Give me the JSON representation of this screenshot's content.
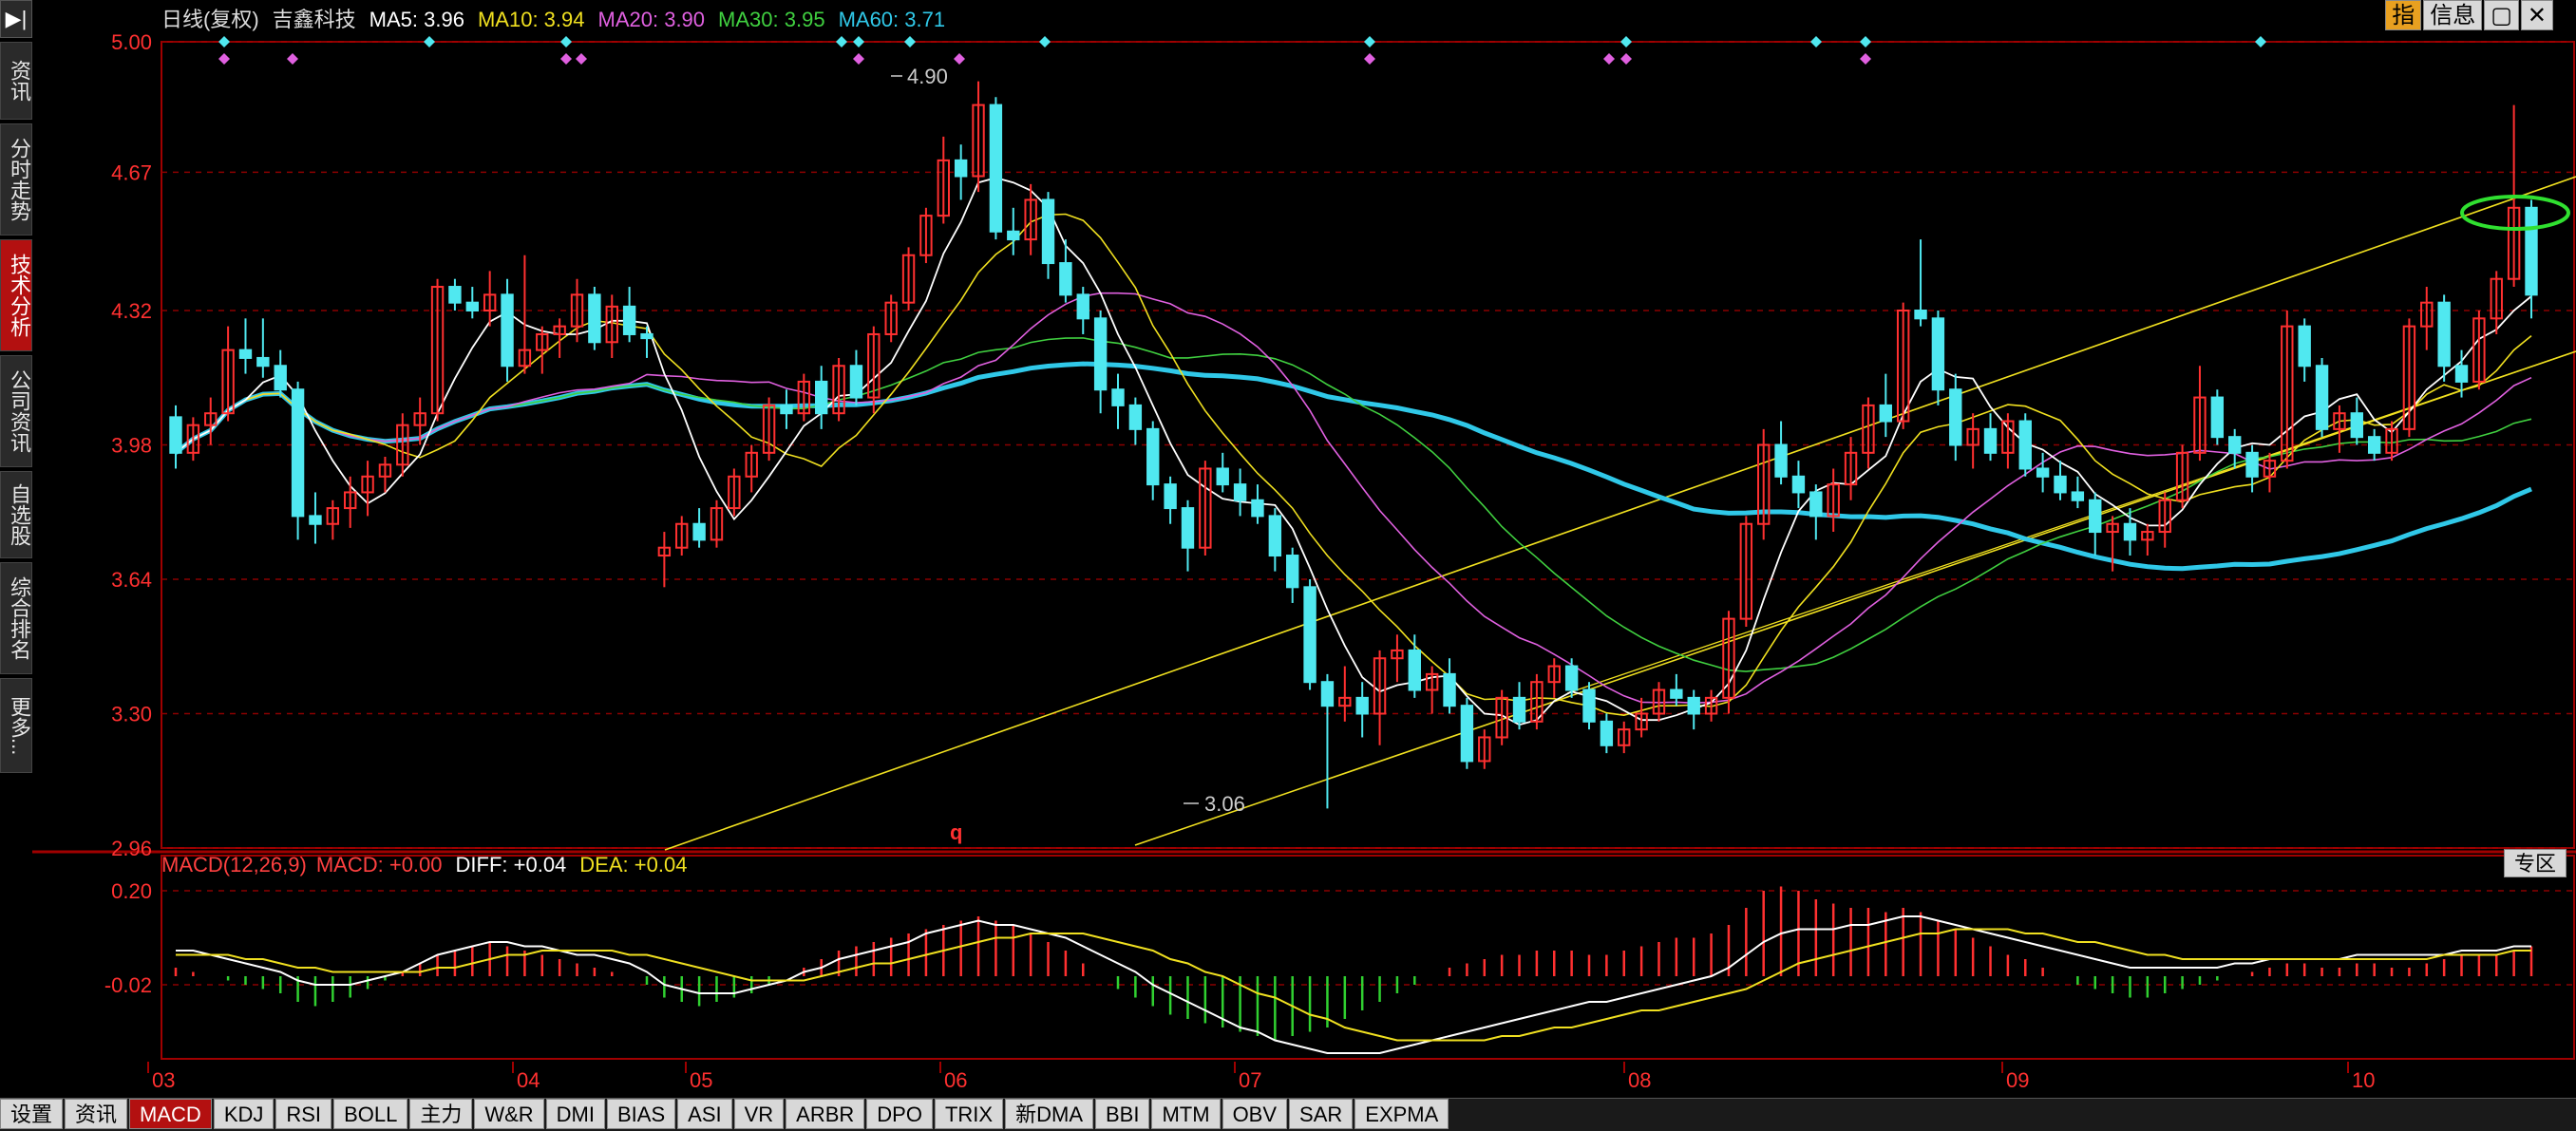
{
  "header": {
    "title": "日线(复权)",
    "stock_name": "吉鑫科技",
    "ma": [
      {
        "label": "MA5:",
        "value": "3.96",
        "color": "#ffffff"
      },
      {
        "label": "MA10:",
        "value": "3.94",
        "color": "#f0e020"
      },
      {
        "label": "MA20:",
        "value": "3.90",
        "color": "#e060e0"
      },
      {
        "label": "MA30:",
        "value": "3.95",
        "color": "#40d040"
      },
      {
        "label": "MA60:",
        "value": "3.71",
        "color": "#30c8e8"
      }
    ]
  },
  "top_buttons": [
    "指",
    "信息",
    "▢",
    "✕"
  ],
  "sidebar": {
    "top_icon": "▶|",
    "items": [
      {
        "label": "资讯"
      },
      {
        "label": "分时走势"
      },
      {
        "label": "技术分析"
      },
      {
        "label": "公司资讯"
      },
      {
        "label": "自选股"
      },
      {
        "label": "综合排名"
      },
      {
        "label": "更多..."
      }
    ]
  },
  "price_axis": {
    "ticks": [
      "5.00",
      "4.67",
      "4.32",
      "3.98",
      "3.64",
      "3.30",
      "2.96"
    ]
  },
  "macd_axis": {
    "ticks": [
      "0.20",
      "-0.02"
    ]
  },
  "macd_header": {
    "label": "MACD(12,26,9)",
    "macd": "MACD: +0.00",
    "diff_label": "DIFF:",
    "diff": "+0.04",
    "dea_label": "DEA:",
    "dea": "+0.04"
  },
  "annotations": {
    "high": "4.90",
    "low": "3.06",
    "marker": "q"
  },
  "zone_button": "专区",
  "date_axis": [
    "03",
    "04",
    "05",
    "06",
    "07",
    "08",
    "09",
    "10"
  ],
  "tabs": [
    "设置",
    "资讯",
    "MACD",
    "KDJ",
    "RSI",
    "BOLL",
    "主力",
    "W&R",
    "DMI",
    "BIAS",
    "ASI",
    "VR",
    "ARBR",
    "DPO",
    "TRIX",
    "新DMA",
    "BBI",
    "MTM",
    "OBV",
    "SAR",
    "EXPMA"
  ],
  "active_tab": "MACD",
  "colors": {
    "up": "#ff3030",
    "down": "#50e8f0",
    "grid": "#8b0000",
    "axis": "#a00000"
  },
  "chart_data": {
    "type": "candlestick",
    "ylim": [
      2.96,
      5.0
    ],
    "candles_o_h_l_c": [
      [
        4.05,
        4.08,
        3.92,
        3.96
      ],
      [
        3.96,
        4.05,
        3.94,
        4.03
      ],
      [
        4.03,
        4.1,
        3.98,
        4.06
      ],
      [
        4.06,
        4.28,
        4.04,
        4.22
      ],
      [
        4.22,
        4.3,
        4.16,
        4.2
      ],
      [
        4.2,
        4.3,
        4.15,
        4.18
      ],
      [
        4.18,
        4.22,
        4.1,
        4.12
      ],
      [
        4.12,
        4.14,
        3.74,
        3.8
      ],
      [
        3.8,
        3.86,
        3.73,
        3.78
      ],
      [
        3.78,
        3.84,
        3.74,
        3.82
      ],
      [
        3.82,
        3.9,
        3.77,
        3.86
      ],
      [
        3.86,
        3.94,
        3.8,
        3.9
      ],
      [
        3.9,
        3.95,
        3.86,
        3.93
      ],
      [
        3.93,
        4.06,
        3.9,
        4.03
      ],
      [
        4.03,
        4.1,
        3.98,
        4.06
      ],
      [
        4.06,
        4.4,
        4.04,
        4.38
      ],
      [
        4.38,
        4.4,
        4.32,
        4.34
      ],
      [
        4.34,
        4.38,
        4.3,
        4.32
      ],
      [
        4.32,
        4.42,
        4.28,
        4.36
      ],
      [
        4.36,
        4.4,
        4.14,
        4.18
      ],
      [
        4.18,
        4.46,
        4.16,
        4.22
      ],
      [
        4.22,
        4.28,
        4.16,
        4.26
      ],
      [
        4.26,
        4.3,
        4.2,
        4.28
      ],
      [
        4.28,
        4.4,
        4.24,
        4.36
      ],
      [
        4.36,
        4.38,
        4.22,
        4.24
      ],
      [
        4.24,
        4.36,
        4.2,
        4.33
      ],
      [
        4.33,
        4.38,
        4.24,
        4.26
      ],
      [
        4.26,
        4.28,
        4.2,
        4.25
      ],
      [
        3.7,
        3.76,
        3.62,
        3.72
      ],
      [
        3.72,
        3.8,
        3.7,
        3.78
      ],
      [
        3.78,
        3.82,
        3.72,
        3.74
      ],
      [
        3.74,
        3.84,
        3.72,
        3.82
      ],
      [
        3.82,
        3.92,
        3.8,
        3.9
      ],
      [
        3.9,
        3.98,
        3.86,
        3.96
      ],
      [
        3.96,
        4.1,
        3.94,
        4.08
      ],
      [
        4.08,
        4.12,
        4.02,
        4.06
      ],
      [
        4.06,
        4.16,
        4.04,
        4.14
      ],
      [
        4.14,
        4.18,
        4.02,
        4.06
      ],
      [
        4.06,
        4.2,
        4.04,
        4.18
      ],
      [
        4.18,
        4.22,
        4.08,
        4.1
      ],
      [
        4.1,
        4.28,
        4.06,
        4.26
      ],
      [
        4.26,
        4.36,
        4.24,
        4.34
      ],
      [
        4.34,
        4.48,
        4.32,
        4.46
      ],
      [
        4.46,
        4.58,
        4.44,
        4.56
      ],
      [
        4.56,
        4.76,
        4.54,
        4.7
      ],
      [
        4.7,
        4.74,
        4.6,
        4.66
      ],
      [
        4.66,
        4.9,
        4.62,
        4.84
      ],
      [
        4.84,
        4.86,
        4.5,
        4.52
      ],
      [
        4.52,
        4.58,
        4.46,
        4.5
      ],
      [
        4.5,
        4.64,
        4.46,
        4.6
      ],
      [
        4.6,
        4.62,
        4.4,
        4.44
      ],
      [
        4.44,
        4.5,
        4.34,
        4.36
      ],
      [
        4.36,
        4.38,
        4.26,
        4.3
      ],
      [
        4.3,
        4.32,
        4.06,
        4.12
      ],
      [
        4.12,
        4.16,
        4.02,
        4.08
      ],
      [
        4.08,
        4.1,
        3.98,
        4.02
      ],
      [
        4.02,
        4.04,
        3.84,
        3.88
      ],
      [
        3.88,
        3.9,
        3.78,
        3.82
      ],
      [
        3.82,
        3.84,
        3.66,
        3.72
      ],
      [
        3.72,
        3.94,
        3.7,
        3.92
      ],
      [
        3.92,
        3.96,
        3.86,
        3.88
      ],
      [
        3.88,
        3.92,
        3.8,
        3.84
      ],
      [
        3.84,
        3.88,
        3.78,
        3.8
      ],
      [
        3.8,
        3.82,
        3.66,
        3.7
      ],
      [
        3.7,
        3.72,
        3.58,
        3.62
      ],
      [
        3.62,
        3.64,
        3.36,
        3.38
      ],
      [
        3.38,
        3.4,
        3.06,
        3.32
      ],
      [
        3.32,
        3.42,
        3.28,
        3.34
      ],
      [
        3.34,
        3.38,
        3.24,
        3.3
      ],
      [
        3.3,
        3.46,
        3.22,
        3.44
      ],
      [
        3.44,
        3.5,
        3.38,
        3.46
      ],
      [
        3.46,
        3.5,
        3.34,
        3.36
      ],
      [
        3.36,
        3.42,
        3.3,
        3.4
      ],
      [
        3.4,
        3.44,
        3.3,
        3.32
      ],
      [
        3.32,
        3.34,
        3.16,
        3.18
      ],
      [
        3.18,
        3.26,
        3.16,
        3.24
      ],
      [
        3.24,
        3.36,
        3.22,
        3.34
      ],
      [
        3.34,
        3.38,
        3.26,
        3.28
      ],
      [
        3.28,
        3.4,
        3.26,
        3.38
      ],
      [
        3.38,
        3.44,
        3.34,
        3.42
      ],
      [
        3.42,
        3.44,
        3.34,
        3.36
      ],
      [
        3.36,
        3.38,
        3.26,
        3.28
      ],
      [
        3.28,
        3.3,
        3.2,
        3.22
      ],
      [
        3.22,
        3.28,
        3.2,
        3.26
      ],
      [
        3.26,
        3.34,
        3.24,
        3.3
      ],
      [
        3.3,
        3.38,
        3.28,
        3.36
      ],
      [
        3.36,
        3.4,
        3.32,
        3.34
      ],
      [
        3.34,
        3.36,
        3.26,
        3.3
      ],
      [
        3.3,
        3.36,
        3.28,
        3.34
      ],
      [
        3.34,
        3.56,
        3.3,
        3.54
      ],
      [
        3.54,
        3.8,
        3.52,
        3.78
      ],
      [
        3.78,
        4.02,
        3.74,
        3.98
      ],
      [
        3.98,
        4.04,
        3.88,
        3.9
      ],
      [
        3.9,
        3.94,
        3.82,
        3.86
      ],
      [
        3.86,
        3.88,
        3.74,
        3.8
      ],
      [
        3.8,
        3.92,
        3.76,
        3.88
      ],
      [
        3.88,
        4.0,
        3.84,
        3.96
      ],
      [
        3.96,
        4.1,
        3.92,
        4.08
      ],
      [
        4.08,
        4.16,
        4.0,
        4.04
      ],
      [
        4.04,
        4.34,
        4.02,
        4.32
      ],
      [
        4.32,
        4.5,
        4.28,
        4.3
      ],
      [
        4.3,
        4.32,
        4.08,
        4.12
      ],
      [
        4.12,
        4.16,
        3.94,
        3.98
      ],
      [
        3.98,
        4.06,
        3.92,
        4.02
      ],
      [
        4.02,
        4.06,
        3.94,
        3.96
      ],
      [
        3.96,
        4.06,
        3.92,
        4.04
      ],
      [
        4.04,
        4.06,
        3.9,
        3.92
      ],
      [
        3.92,
        3.96,
        3.86,
        3.9
      ],
      [
        3.9,
        3.94,
        3.84,
        3.86
      ],
      [
        3.86,
        3.9,
        3.82,
        3.84
      ],
      [
        3.84,
        3.86,
        3.7,
        3.76
      ],
      [
        3.76,
        3.8,
        3.66,
        3.78
      ],
      [
        3.78,
        3.82,
        3.7,
        3.74
      ],
      [
        3.74,
        3.78,
        3.7,
        3.76
      ],
      [
        3.76,
        3.86,
        3.72,
        3.84
      ],
      [
        3.84,
        3.98,
        3.82,
        3.96
      ],
      [
        3.96,
        4.18,
        3.94,
        4.1
      ],
      [
        4.1,
        4.12,
        3.98,
        4.0
      ],
      [
        4.0,
        4.02,
        3.92,
        3.96
      ],
      [
        3.96,
        3.98,
        3.86,
        3.9
      ],
      [
        3.9,
        3.96,
        3.86,
        3.94
      ],
      [
        3.94,
        4.32,
        3.92,
        4.28
      ],
      [
        4.28,
        4.3,
        4.14,
        4.18
      ],
      [
        4.18,
        4.2,
        4.0,
        4.02
      ],
      [
        4.02,
        4.08,
        3.96,
        4.06
      ],
      [
        4.06,
        4.1,
        3.98,
        4.0
      ],
      [
        4.0,
        4.02,
        3.94,
        3.96
      ],
      [
        3.96,
        4.04,
        3.94,
        4.02
      ],
      [
        4.02,
        4.3,
        4.0,
        4.28
      ],
      [
        4.28,
        4.38,
        4.22,
        4.34
      ],
      [
        4.34,
        4.36,
        4.14,
        4.18
      ],
      [
        4.18,
        4.22,
        4.1,
        4.14
      ],
      [
        4.14,
        4.32,
        4.12,
        4.3
      ],
      [
        4.3,
        4.42,
        4.26,
        4.4
      ],
      [
        4.4,
        4.84,
        4.38,
        4.58
      ],
      [
        4.58,
        4.6,
        4.3,
        4.36
      ]
    ],
    "macd_hist": [
      0.02,
      0.01,
      0.0,
      -0.01,
      -0.02,
      -0.03,
      -0.04,
      -0.06,
      -0.07,
      -0.06,
      -0.05,
      -0.03,
      -0.01,
      0.01,
      0.03,
      0.05,
      0.06,
      0.07,
      0.08,
      0.07,
      0.06,
      0.05,
      0.04,
      0.03,
      0.02,
      0.01,
      0.0,
      -0.02,
      -0.05,
      -0.06,
      -0.07,
      -0.06,
      -0.05,
      -0.04,
      -0.02,
      0.0,
      0.02,
      0.04,
      0.06,
      0.07,
      0.08,
      0.09,
      0.1,
      0.11,
      0.12,
      0.13,
      0.14,
      0.13,
      0.12,
      0.1,
      0.08,
      0.06,
      0.03,
      0.0,
      -0.03,
      -0.05,
      -0.07,
      -0.09,
      -0.1,
      -0.11,
      -0.12,
      -0.13,
      -0.14,
      -0.15,
      -0.14,
      -0.13,
      -0.12,
      -0.1,
      -0.08,
      -0.06,
      -0.04,
      -0.02,
      0.0,
      0.02,
      0.03,
      0.04,
      0.05,
      0.05,
      0.06,
      0.06,
      0.06,
      0.05,
      0.05,
      0.06,
      0.07,
      0.08,
      0.09,
      0.09,
      0.1,
      0.12,
      0.16,
      0.2,
      0.21,
      0.2,
      0.18,
      0.17,
      0.16,
      0.16,
      0.15,
      0.16,
      0.15,
      0.13,
      0.11,
      0.09,
      0.07,
      0.05,
      0.04,
      0.02,
      0.0,
      -0.02,
      -0.03,
      -0.04,
      -0.05,
      -0.05,
      -0.04,
      -0.03,
      -0.02,
      -0.01,
      0.0,
      0.01,
      0.02,
      0.03,
      0.03,
      0.02,
      0.02,
      0.03,
      0.03,
      0.02,
      0.02,
      0.03,
      0.04,
      0.05,
      0.05,
      0.05,
      0.06,
      0.07,
      0.08,
      0.07
    ],
    "diff": [
      0.06,
      0.06,
      0.05,
      0.04,
      0.03,
      0.02,
      0.01,
      -0.01,
      -0.02,
      -0.02,
      -0.02,
      -0.01,
      0.0,
      0.01,
      0.03,
      0.05,
      0.06,
      0.07,
      0.08,
      0.08,
      0.07,
      0.07,
      0.06,
      0.05,
      0.05,
      0.04,
      0.03,
      0.01,
      -0.02,
      -0.03,
      -0.04,
      -0.04,
      -0.04,
      -0.03,
      -0.02,
      -0.01,
      0.01,
      0.02,
      0.04,
      0.05,
      0.06,
      0.07,
      0.08,
      0.1,
      0.11,
      0.12,
      0.13,
      0.12,
      0.12,
      0.11,
      0.1,
      0.09,
      0.07,
      0.05,
      0.03,
      0.01,
      -0.02,
      -0.04,
      -0.06,
      -0.08,
      -0.1,
      -0.12,
      -0.13,
      -0.15,
      -0.16,
      -0.17,
      -0.18,
      -0.18,
      -0.18,
      -0.18,
      -0.17,
      -0.16,
      -0.15,
      -0.14,
      -0.13,
      -0.12,
      -0.11,
      -0.1,
      -0.09,
      -0.08,
      -0.07,
      -0.06,
      -0.06,
      -0.05,
      -0.04,
      -0.03,
      -0.02,
      -0.01,
      0.0,
      0.02,
      0.05,
      0.08,
      0.1,
      0.11,
      0.11,
      0.11,
      0.12,
      0.12,
      0.13,
      0.14,
      0.14,
      0.13,
      0.12,
      0.11,
      0.1,
      0.09,
      0.08,
      0.07,
      0.06,
      0.05,
      0.04,
      0.03,
      0.02,
      0.02,
      0.02,
      0.02,
      0.02,
      0.02,
      0.03,
      0.03,
      0.04,
      0.04,
      0.04,
      0.04,
      0.04,
      0.05,
      0.05,
      0.05,
      0.05,
      0.05,
      0.05,
      0.06,
      0.06,
      0.06,
      0.07,
      0.07,
      0.08,
      0.09,
      0.08,
      0.07
    ],
    "dea": [
      0.05,
      0.05,
      0.05,
      0.05,
      0.04,
      0.04,
      0.03,
      0.02,
      0.02,
      0.01,
      0.01,
      0.01,
      0.01,
      0.01,
      0.01,
      0.02,
      0.02,
      0.03,
      0.04,
      0.05,
      0.05,
      0.06,
      0.06,
      0.06,
      0.06,
      0.06,
      0.05,
      0.05,
      0.04,
      0.03,
      0.02,
      0.01,
      0.0,
      -0.01,
      -0.01,
      -0.01,
      -0.01,
      0.0,
      0.01,
      0.02,
      0.03,
      0.03,
      0.04,
      0.05,
      0.06,
      0.07,
      0.08,
      0.09,
      0.09,
      0.1,
      0.1,
      0.1,
      0.1,
      0.09,
      0.08,
      0.07,
      0.06,
      0.04,
      0.03,
      0.01,
      0.0,
      -0.02,
      -0.04,
      -0.05,
      -0.07,
      -0.09,
      -0.1,
      -0.12,
      -0.13,
      -0.14,
      -0.15,
      -0.15,
      -0.15,
      -0.15,
      -0.15,
      -0.15,
      -0.14,
      -0.14,
      -0.13,
      -0.12,
      -0.12,
      -0.11,
      -0.1,
      -0.09,
      -0.08,
      -0.08,
      -0.07,
      -0.06,
      -0.05,
      -0.04,
      -0.03,
      -0.01,
      0.01,
      0.03,
      0.04,
      0.05,
      0.06,
      0.07,
      0.08,
      0.09,
      0.1,
      0.1,
      0.11,
      0.11,
      0.11,
      0.11,
      0.1,
      0.1,
      0.09,
      0.08,
      0.08,
      0.07,
      0.06,
      0.05,
      0.05,
      0.04,
      0.04,
      0.04,
      0.04,
      0.04,
      0.04,
      0.04,
      0.04,
      0.04,
      0.04,
      0.04,
      0.04,
      0.04,
      0.04,
      0.04,
      0.05,
      0.05,
      0.05,
      0.05,
      0.06,
      0.06,
      0.07,
      0.07,
      0.07,
      0.07
    ]
  }
}
